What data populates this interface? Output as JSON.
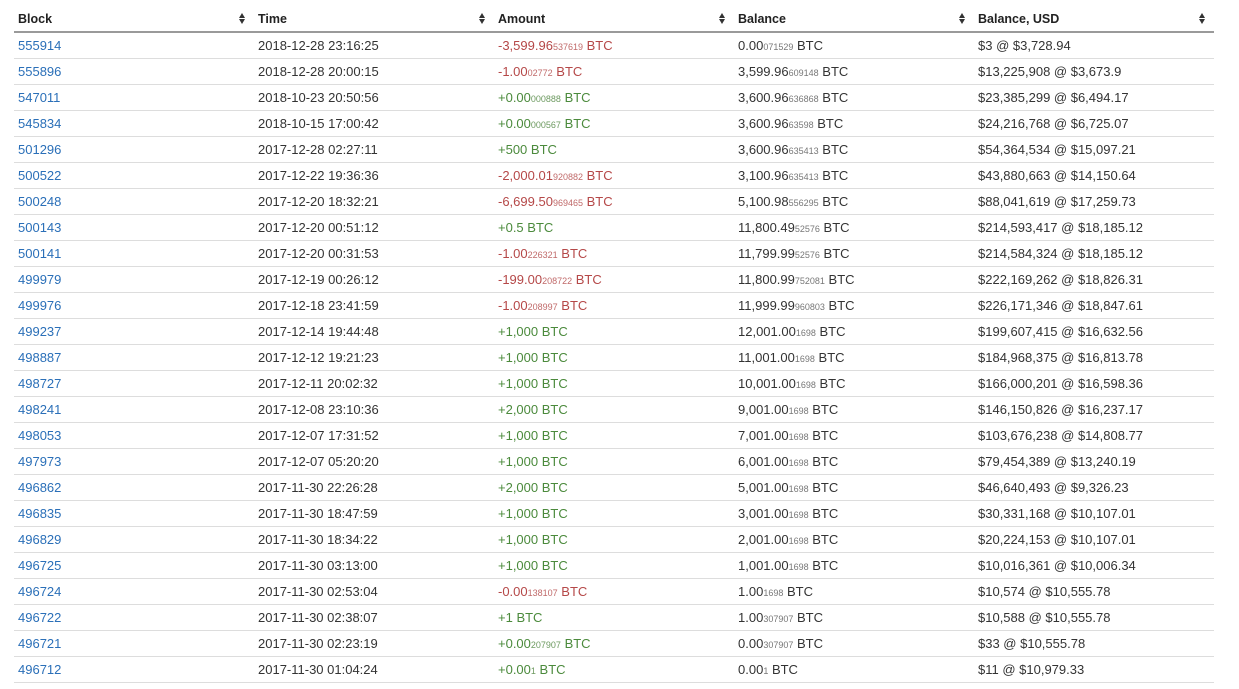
{
  "table": {
    "headers": [
      {
        "label": "Block"
      },
      {
        "label": "Time"
      },
      {
        "label": "Amount"
      },
      {
        "label": "Balance"
      },
      {
        "label": "Balance, USD"
      }
    ],
    "rows": [
      {
        "block": "555914",
        "time": "2018-12-28 23:16:25",
        "amount_main": "-3,599.96",
        "amount_small": "537619",
        "amount_unit": " BTC",
        "sign": "neg",
        "balance_main": "0.00",
        "balance_small": "071529",
        "balance_unit": " BTC",
        "usd": "$3 @ $3,728.94"
      },
      {
        "block": "555896",
        "time": "2018-12-28 20:00:15",
        "amount_main": "-1.00",
        "amount_small": "02772",
        "amount_unit": " BTC",
        "sign": "neg",
        "balance_main": "3,599.96",
        "balance_small": "609148",
        "balance_unit": " BTC",
        "usd": "$13,225,908 @ $3,673.9"
      },
      {
        "block": "547011",
        "time": "2018-10-23 20:50:56",
        "amount_main": "+0.00",
        "amount_small": "000888",
        "amount_unit": " BTC",
        "sign": "pos",
        "balance_main": "3,600.96",
        "balance_small": "636868",
        "balance_unit": " BTC",
        "usd": "$23,385,299 @ $6,494.17"
      },
      {
        "block": "545834",
        "time": "2018-10-15 17:00:42",
        "amount_main": "+0.00",
        "amount_small": "000567",
        "amount_unit": " BTC",
        "sign": "pos",
        "balance_main": "3,600.96",
        "balance_small": "63598",
        "balance_unit": " BTC",
        "usd": "$24,216,768 @ $6,725.07"
      },
      {
        "block": "501296",
        "time": "2017-12-28 02:27:11",
        "amount_main": "+500",
        "amount_small": "",
        "amount_unit": " BTC",
        "sign": "pos",
        "balance_main": "3,600.96",
        "balance_small": "635413",
        "balance_unit": " BTC",
        "usd": "$54,364,534 @ $15,097.21"
      },
      {
        "block": "500522",
        "time": "2017-12-22 19:36:36",
        "amount_main": "-2,000.01",
        "amount_small": "920882",
        "amount_unit": " BTC",
        "sign": "neg",
        "balance_main": "3,100.96",
        "balance_small": "635413",
        "balance_unit": " BTC",
        "usd": "$43,880,663 @ $14,150.64"
      },
      {
        "block": "500248",
        "time": "2017-12-20 18:32:21",
        "amount_main": "-6,699.50",
        "amount_small": "969465",
        "amount_unit": " BTC",
        "sign": "neg",
        "balance_main": "5,100.98",
        "balance_small": "556295",
        "balance_unit": " BTC",
        "usd": "$88,041,619 @ $17,259.73"
      },
      {
        "block": "500143",
        "time": "2017-12-20 00:51:12",
        "amount_main": "+0.5",
        "amount_small": "",
        "amount_unit": " BTC",
        "sign": "pos",
        "balance_main": "11,800.49",
        "balance_small": "52576",
        "balance_unit": " BTC",
        "usd": "$214,593,417 @ $18,185.12"
      },
      {
        "block": "500141",
        "time": "2017-12-20 00:31:53",
        "amount_main": "-1.00",
        "amount_small": "226321",
        "amount_unit": " BTC",
        "sign": "neg",
        "balance_main": "11,799.99",
        "balance_small": "52576",
        "balance_unit": " BTC",
        "usd": "$214,584,324 @ $18,185.12"
      },
      {
        "block": "499979",
        "time": "2017-12-19 00:26:12",
        "amount_main": "-199.00",
        "amount_small": "208722",
        "amount_unit": " BTC",
        "sign": "neg",
        "balance_main": "11,800.99",
        "balance_small": "752081",
        "balance_unit": " BTC",
        "usd": "$222,169,262 @ $18,826.31"
      },
      {
        "block": "499976",
        "time": "2017-12-18 23:41:59",
        "amount_main": "-1.00",
        "amount_small": "208997",
        "amount_unit": " BTC",
        "sign": "neg",
        "balance_main": "11,999.99",
        "balance_small": "960803",
        "balance_unit": " BTC",
        "usd": "$226,171,346 @ $18,847.61"
      },
      {
        "block": "499237",
        "time": "2017-12-14 19:44:48",
        "amount_main": "+1,000",
        "amount_small": "",
        "amount_unit": " BTC",
        "sign": "pos",
        "balance_main": "12,001.00",
        "balance_small": "1698",
        "balance_unit": " BTC",
        "usd": "$199,607,415 @ $16,632.56"
      },
      {
        "block": "498887",
        "time": "2017-12-12 19:21:23",
        "amount_main": "+1,000",
        "amount_small": "",
        "amount_unit": " BTC",
        "sign": "pos",
        "balance_main": "11,001.00",
        "balance_small": "1698",
        "balance_unit": " BTC",
        "usd": "$184,968,375 @ $16,813.78"
      },
      {
        "block": "498727",
        "time": "2017-12-11 20:02:32",
        "amount_main": "+1,000",
        "amount_small": "",
        "amount_unit": " BTC",
        "sign": "pos",
        "balance_main": "10,001.00",
        "balance_small": "1698",
        "balance_unit": " BTC",
        "usd": "$166,000,201 @ $16,598.36"
      },
      {
        "block": "498241",
        "time": "2017-12-08 23:10:36",
        "amount_main": "+2,000",
        "amount_small": "",
        "amount_unit": " BTC",
        "sign": "pos",
        "balance_main": "9,001.00",
        "balance_small": "1698",
        "balance_unit": " BTC",
        "usd": "$146,150,826 @ $16,237.17"
      },
      {
        "block": "498053",
        "time": "2017-12-07 17:31:52",
        "amount_main": "+1,000",
        "amount_small": "",
        "amount_unit": " BTC",
        "sign": "pos",
        "balance_main": "7,001.00",
        "balance_small": "1698",
        "balance_unit": " BTC",
        "usd": "$103,676,238 @ $14,808.77"
      },
      {
        "block": "497973",
        "time": "2017-12-07 05:20:20",
        "amount_main": "+1,000",
        "amount_small": "",
        "amount_unit": " BTC",
        "sign": "pos",
        "balance_main": "6,001.00",
        "balance_small": "1698",
        "balance_unit": " BTC",
        "usd": "$79,454,389 @ $13,240.19"
      },
      {
        "block": "496862",
        "time": "2017-11-30 22:26:28",
        "amount_main": "+2,000",
        "amount_small": "",
        "amount_unit": " BTC",
        "sign": "pos",
        "balance_main": "5,001.00",
        "balance_small": "1698",
        "balance_unit": " BTC",
        "usd": "$46,640,493 @ $9,326.23"
      },
      {
        "block": "496835",
        "time": "2017-11-30 18:47:59",
        "amount_main": "+1,000",
        "amount_small": "",
        "amount_unit": " BTC",
        "sign": "pos",
        "balance_main": "3,001.00",
        "balance_small": "1698",
        "balance_unit": " BTC",
        "usd": "$30,331,168 @ $10,107.01"
      },
      {
        "block": "496829",
        "time": "2017-11-30 18:34:22",
        "amount_main": "+1,000",
        "amount_small": "",
        "amount_unit": " BTC",
        "sign": "pos",
        "balance_main": "2,001.00",
        "balance_small": "1698",
        "balance_unit": " BTC",
        "usd": "$20,224,153 @ $10,107.01"
      },
      {
        "block": "496725",
        "time": "2017-11-30 03:13:00",
        "amount_main": "+1,000",
        "amount_small": "",
        "amount_unit": " BTC",
        "sign": "pos",
        "balance_main": "1,001.00",
        "balance_small": "1698",
        "balance_unit": " BTC",
        "usd": "$10,016,361 @ $10,006.34"
      },
      {
        "block": "496724",
        "time": "2017-11-30 02:53:04",
        "amount_main": "-0.00",
        "amount_small": "138107",
        "amount_unit": " BTC",
        "sign": "neg",
        "balance_main": "1.00",
        "balance_small": "1698",
        "balance_unit": " BTC",
        "usd": "$10,574 @ $10,555.78"
      },
      {
        "block": "496722",
        "time": "2017-11-30 02:38:07",
        "amount_main": "+1",
        "amount_small": "",
        "amount_unit": " BTC",
        "sign": "pos",
        "balance_main": "1.00",
        "balance_small": "307907",
        "balance_unit": " BTC",
        "usd": "$10,588 @ $10,555.78"
      },
      {
        "block": "496721",
        "time": "2017-11-30 02:23:19",
        "amount_main": "+0.00",
        "amount_small": "207907",
        "amount_unit": " BTC",
        "sign": "pos",
        "balance_main": "0.00",
        "balance_small": "307907",
        "balance_unit": " BTC",
        "usd": "$33 @ $10,555.78"
      },
      {
        "block": "496712",
        "time": "2017-11-30 01:04:24",
        "amount_main": "+0.00",
        "amount_small": "1",
        "amount_unit": " BTC",
        "sign": "pos",
        "balance_main": "0.00",
        "balance_small": "1",
        "balance_unit": " BTC",
        "usd": "$11 @ $10,979.33"
      }
    ]
  },
  "colors": {
    "link": "#2a6fb8",
    "negative": "#b54848",
    "positive": "#4b8a3c",
    "text": "#333333",
    "header_border": "#9a9a9a",
    "row_border": "#dddddd"
  },
  "icons": {
    "sort": "sort-icon"
  }
}
